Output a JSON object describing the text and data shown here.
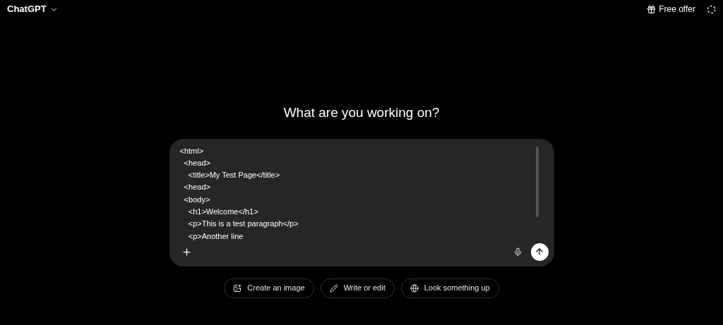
{
  "header": {
    "model": "ChatGPT",
    "offer": "Free offer"
  },
  "heading": "What are you working on?",
  "composer": {
    "value": "<html>\n  <head>\n    <title>My Test Page</title>\n  <head>\n  <body>\n    <h1>Welcome</h1>\n    <p>This is a test paragraph</p>\n    <p>Another line"
  },
  "suggestions": [
    {
      "kind": "image",
      "label": "Create an image"
    },
    {
      "kind": "write",
      "label": "Write or edit"
    },
    {
      "kind": "search",
      "label": "Look something up"
    }
  ]
}
